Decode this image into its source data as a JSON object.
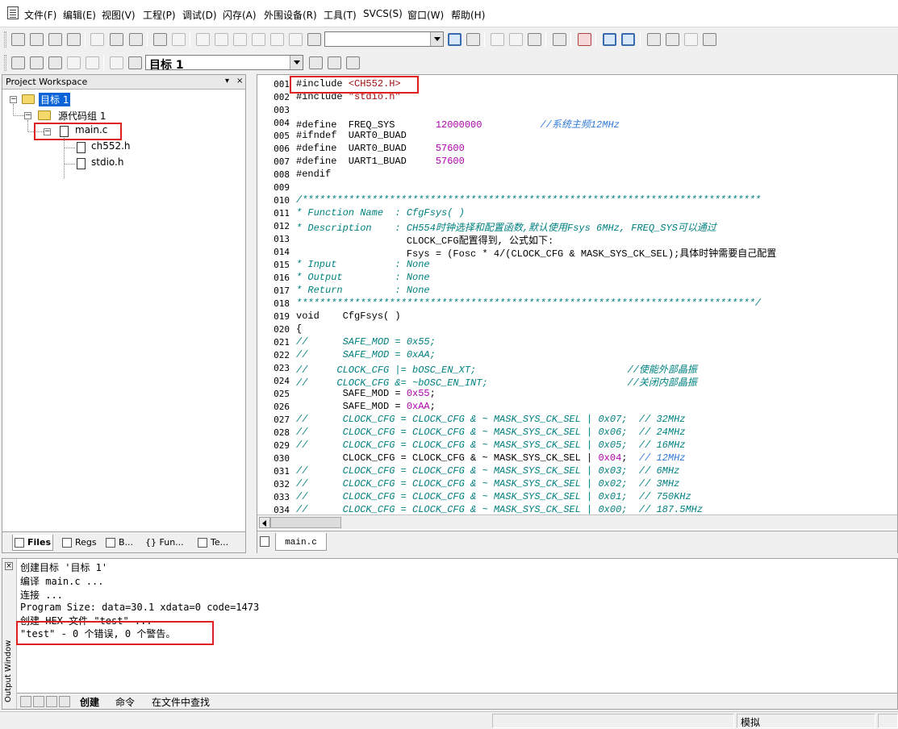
{
  "menu": [
    "文件(F)",
    "编辑(E)",
    "视图(V)",
    "工程(P)",
    "调试(D)",
    "闪存(A)",
    "外围设备(R)",
    "工具(T)",
    "SVCS(S)",
    "窗口(W)",
    "帮助(H)"
  ],
  "toolbar": {
    "target_combo": "目标 1",
    "find_combo": ""
  },
  "workspace": {
    "title": "Project Workspace",
    "buttons": [
      "▾",
      "×"
    ],
    "tree": {
      "target": "目标 1",
      "group": "源代码组 1",
      "file": "main.c",
      "children": [
        "ch552.h",
        "stdio.h"
      ]
    },
    "tabs": [
      "Files",
      "Regs",
      "B...",
      "{} Fun...",
      "Te..."
    ]
  },
  "editor": {
    "tab": "main.c",
    "lines": [
      {
        "n": "001",
        "t": "#include <CH552.H>"
      },
      {
        "n": "002",
        "t": "#include \"stdio.h\""
      },
      {
        "n": "003",
        "t": ""
      },
      {
        "n": "004",
        "t": "#define  FREQ_SYS       12000000          //系统主频12MHz"
      },
      {
        "n": "005",
        "t": "#ifndef  UART0_BUAD"
      },
      {
        "n": "006",
        "t": "#define  UART0_BUAD     57600"
      },
      {
        "n": "007",
        "t": "#define  UART1_BUAD     57600"
      },
      {
        "n": "008",
        "t": "#endif"
      },
      {
        "n": "009",
        "t": ""
      },
      {
        "n": "010",
        "t": "/*******************************************************************************"
      },
      {
        "n": "011",
        "t": "* Function Name  : CfgFsys( )"
      },
      {
        "n": "012",
        "t": "* Description    : CH554时钟选择和配置函数,默认使用Fsys 6MHz, FREQ_SYS可以通过"
      },
      {
        "n": "013",
        "t": "                   CLOCK_CFG配置得到, 公式如下:"
      },
      {
        "n": "014",
        "t": "                   Fsys = (Fosc * 4/(CLOCK_CFG & MASK_SYS_CK_SEL);具体时钟需要自己配置"
      },
      {
        "n": "015",
        "t": "* Input          : None"
      },
      {
        "n": "016",
        "t": "* Output         : None"
      },
      {
        "n": "017",
        "t": "* Return         : None"
      },
      {
        "n": "018",
        "t": "*******************************************************************************/"
      },
      {
        "n": "019",
        "t": "void    CfgFsys( )"
      },
      {
        "n": "020",
        "t": "{"
      },
      {
        "n": "021",
        "t": "//      SAFE_MOD = 0x55;"
      },
      {
        "n": "022",
        "t": "//      SAFE_MOD = 0xAA;"
      },
      {
        "n": "023",
        "t": "//     CLOCK_CFG |= bOSC_EN_XT;                          //使能外部晶振"
      },
      {
        "n": "024",
        "t": "//     CLOCK_CFG &= ~bOSC_EN_INT;                        //关闭内部晶振"
      },
      {
        "n": "025",
        "t": "        SAFE_MOD = 0x55;"
      },
      {
        "n": "026",
        "t": "        SAFE_MOD = 0xAA;"
      },
      {
        "n": "027",
        "t": "//      CLOCK_CFG = CLOCK_CFG & ~ MASK_SYS_CK_SEL | 0x07;  // 32MHz"
      },
      {
        "n": "028",
        "t": "//      CLOCK_CFG = CLOCK_CFG & ~ MASK_SYS_CK_SEL | 0x06;  // 24MHz"
      },
      {
        "n": "029",
        "t": "//      CLOCK_CFG = CLOCK_CFG & ~ MASK_SYS_CK_SEL | 0x05;  // 16MHz"
      },
      {
        "n": "030",
        "t": "        CLOCK_CFG = CLOCK_CFG & ~ MASK_SYS_CK_SEL | 0x04;  // 12MHz"
      },
      {
        "n": "031",
        "t": "//      CLOCK_CFG = CLOCK_CFG & ~ MASK_SYS_CK_SEL | 0x03;  // 6MHz"
      },
      {
        "n": "032",
        "t": "//      CLOCK_CFG = CLOCK_CFG & ~ MASK_SYS_CK_SEL | 0x02;  // 3MHz"
      },
      {
        "n": "033",
        "t": "//      CLOCK_CFG = CLOCK_CFG & ~ MASK_SYS_CK_SEL | 0x01;  // 750KHz"
      },
      {
        "n": "034",
        "t": "//      CLOCK_CFG = CLOCK_CFG & ~ MASK_SYS_CK_SEL | 0x00;  // 187.5MHz"
      }
    ]
  },
  "output": {
    "side_label": "Output Window",
    "lines": [
      "创建目标 '目标 1'",
      "编译 main.c ...",
      "连接 ...",
      "Program Size: data=30.1 xdata=0 code=1473",
      "创建 HEX 文件 \"test\" ...",
      "\"test\" - 0 个错误, 0 个警告。"
    ],
    "tabs": [
      "创建",
      "命令",
      "在文件中查找"
    ]
  },
  "status": {
    "mode": "模拟"
  },
  "colors": {
    "highlight": "#e02020",
    "selection": "#0a64d8",
    "comment": "#008080",
    "number": "#b000b0"
  }
}
